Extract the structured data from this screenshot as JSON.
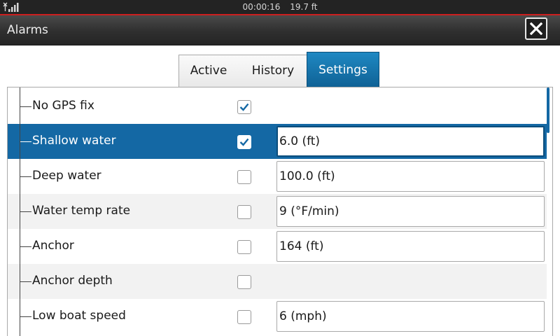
{
  "status_bar": {
    "time": "00:00:16",
    "depth": "19.7 ft"
  },
  "window": {
    "title": "Alarms",
    "close_icon": "close-icon"
  },
  "tabs": [
    {
      "label": "Active",
      "selected": false
    },
    {
      "label": "History",
      "selected": false
    },
    {
      "label": "Settings",
      "selected": true
    }
  ],
  "colors": {
    "accent": "#1468a4",
    "status_line": "#cc1f1f",
    "title_bar": "#2f2f2f"
  },
  "alarms": [
    {
      "label": "No GPS fix",
      "checked": true,
      "value": null,
      "selected": false
    },
    {
      "label": "Shallow water",
      "checked": true,
      "value": "6.0 (ft)",
      "selected": true
    },
    {
      "label": "Deep water",
      "checked": false,
      "value": "100.0 (ft)",
      "selected": false
    },
    {
      "label": "Water temp rate",
      "checked": false,
      "value": "9 (°F/min)",
      "selected": false
    },
    {
      "label": "Anchor",
      "checked": false,
      "value": "164 (ft)",
      "selected": false
    },
    {
      "label": "Anchor depth",
      "checked": false,
      "value": null,
      "selected": false
    },
    {
      "label": "Low boat speed",
      "checked": false,
      "value": "6 (mph)",
      "selected": false
    }
  ]
}
